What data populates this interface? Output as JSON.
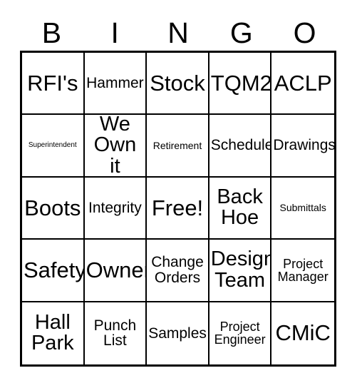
{
  "header": {
    "letters": [
      "B",
      "I",
      "N",
      "G",
      "O"
    ]
  },
  "grid": {
    "rows": [
      [
        {
          "label": "RFI's",
          "size": "sz-xl"
        },
        {
          "label": "Hammer",
          "size": "sz-md"
        },
        {
          "label": "Stock",
          "size": "sz-xl"
        },
        {
          "label": "TQM2",
          "size": "sz-xl"
        },
        {
          "label": "ACLP",
          "size": "sz-xl"
        }
      ],
      [
        {
          "label": "Superintendent",
          "size": "sz-xxs"
        },
        {
          "label": "We\nOwn it",
          "size": "sz-lg"
        },
        {
          "label": "Retirement",
          "size": "sz-xs"
        },
        {
          "label": "Schedule",
          "size": "sz-md"
        },
        {
          "label": "Drawings",
          "size": "sz-md"
        }
      ],
      [
        {
          "label": "Boots",
          "size": "sz-xl"
        },
        {
          "label": "Integrity",
          "size": "sz-md"
        },
        {
          "label": "Free!",
          "size": "sz-xl"
        },
        {
          "label": "Back\nHoe",
          "size": "sz-lg"
        },
        {
          "label": "Submittals",
          "size": "sz-xs"
        }
      ],
      [
        {
          "label": "Safety",
          "size": "sz-xl"
        },
        {
          "label": "Owner",
          "size": "sz-xl"
        },
        {
          "label": "Change\nOrders",
          "size": "sz-md"
        },
        {
          "label": "Design\nTeam",
          "size": "sz-lg"
        },
        {
          "label": "Project\nManager",
          "size": "sz-sm"
        }
      ],
      [
        {
          "label": "Hall\nPark",
          "size": "sz-lg"
        },
        {
          "label": "Punch\nList",
          "size": "sz-md"
        },
        {
          "label": "Samples",
          "size": "sz-md"
        },
        {
          "label": "Project\nEngineer",
          "size": "sz-sm"
        },
        {
          "label": "CMiC",
          "size": "sz-xl"
        }
      ]
    ]
  },
  "colors": {
    "border": "#000000",
    "background": "#ffffff",
    "text": "#000000"
  }
}
